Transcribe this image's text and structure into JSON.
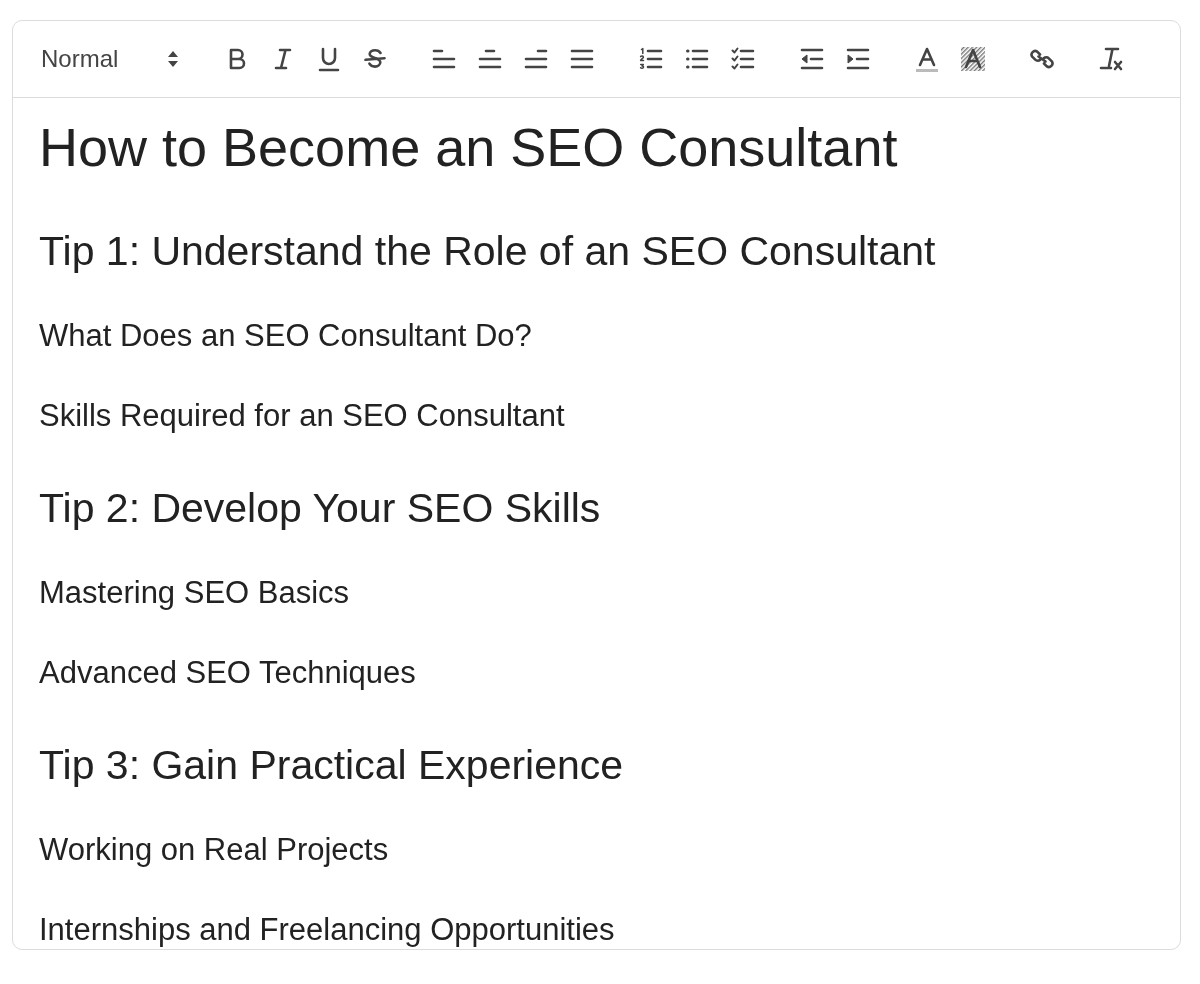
{
  "toolbar": {
    "format_select": {
      "value": "Normal"
    },
    "groups": [
      {
        "buttons": [
          {
            "kind": "bold"
          },
          {
            "kind": "italic"
          },
          {
            "kind": "underline"
          },
          {
            "kind": "strike"
          }
        ]
      },
      {
        "buttons": [
          {
            "kind": "align_left"
          },
          {
            "kind": "align_center"
          },
          {
            "kind": "align_right"
          },
          {
            "kind": "justify"
          }
        ]
      },
      {
        "buttons": [
          {
            "kind": "ordered_list"
          },
          {
            "kind": "bullet_list"
          },
          {
            "kind": "check_list"
          }
        ]
      },
      {
        "buttons": [
          {
            "kind": "outdent"
          },
          {
            "kind": "indent"
          }
        ]
      },
      {
        "buttons": [
          {
            "kind": "text_color"
          },
          {
            "kind": "background_color"
          }
        ]
      },
      {
        "buttons": [
          {
            "kind": "link"
          }
        ]
      },
      {
        "buttons": [
          {
            "kind": "clean"
          }
        ]
      }
    ]
  },
  "document": [
    {
      "kind": "h1",
      "text": "How to Become an SEO Consultant"
    },
    {
      "kind": "h2",
      "text": "Tip 1: Understand the Role of an SEO Consultant"
    },
    {
      "kind": "h3",
      "text": "What Does an SEO Consultant Do?"
    },
    {
      "kind": "h3",
      "text": "Skills Required for an SEO Consultant"
    },
    {
      "kind": "h2",
      "text": "Tip 2: Develop Your SEO Skills"
    },
    {
      "kind": "h3",
      "text": "Mastering SEO Basics"
    },
    {
      "kind": "h3",
      "text": "Advanced SEO Techniques"
    },
    {
      "kind": "h2",
      "text": "Tip 3: Gain Practical Experience"
    },
    {
      "kind": "h3",
      "text": "Working on Real Projects"
    },
    {
      "kind": "h3",
      "text": "Internships and Freelancing Opportunities"
    }
  ]
}
